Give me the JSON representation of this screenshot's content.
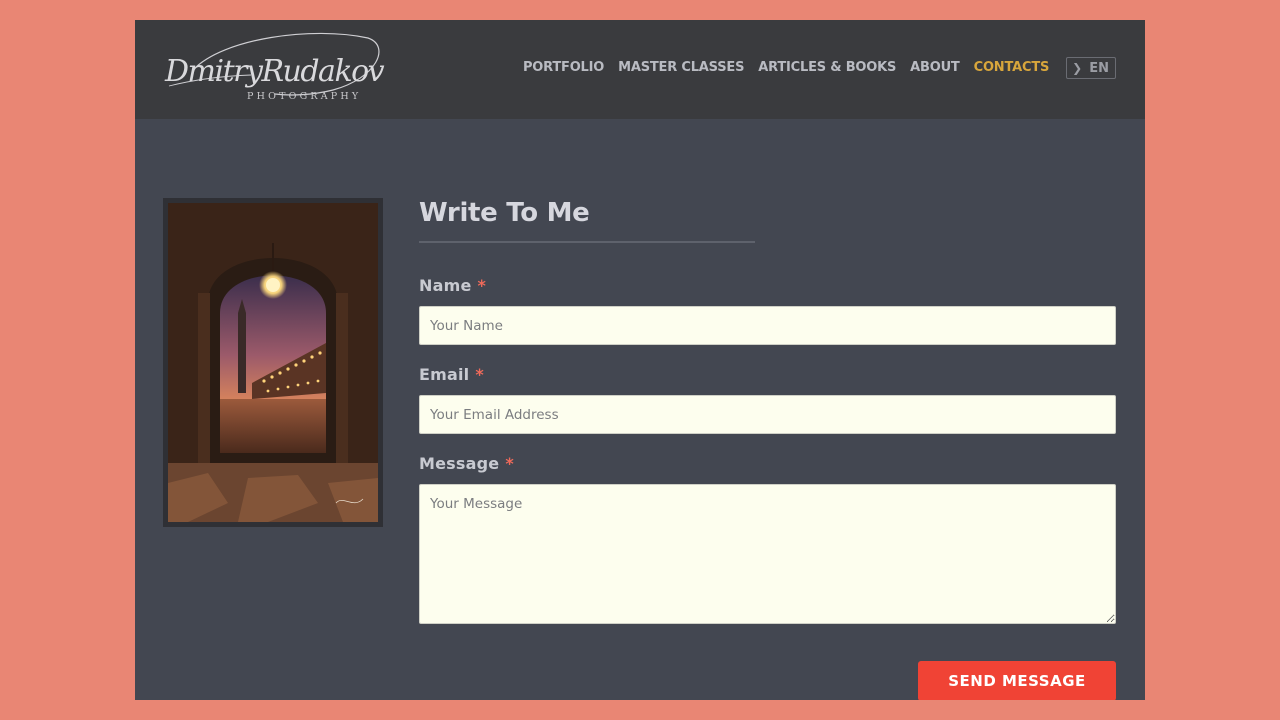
{
  "logo": {
    "name": "DmitryRudakov",
    "tagline": "PHOTOGRAPHY"
  },
  "nav": {
    "items": [
      {
        "label": "PORTFOLIO"
      },
      {
        "label": "MASTER CLASSES"
      },
      {
        "label": "ARTICLES & BOOKS"
      },
      {
        "label": "ABOUT"
      },
      {
        "label": "CONTACTS",
        "active": true
      }
    ],
    "language": "EN",
    "language_icon": "chevron-right-icon"
  },
  "photo": {
    "subject": "Venice arcade at dusk with St. Mark's Campanile"
  },
  "form": {
    "title": "Write To Me",
    "name": {
      "label": "Name",
      "required_mark": "*",
      "placeholder": "Your Name",
      "value": ""
    },
    "email": {
      "label": "Email",
      "required_mark": "*",
      "placeholder": "Your Email Address",
      "value": ""
    },
    "message": {
      "label": "Message",
      "required_mark": "*",
      "placeholder": "Your Message",
      "value": ""
    },
    "submit_label": "SEND MESSAGE"
  },
  "colors": {
    "page_background": "#e98674",
    "header_background": "#3a3b3e",
    "content_background": "#434751",
    "nav_active": "#d8a63c",
    "required": "#ef6a5a",
    "button": "#f04335",
    "input_background": "#fdfeee"
  }
}
